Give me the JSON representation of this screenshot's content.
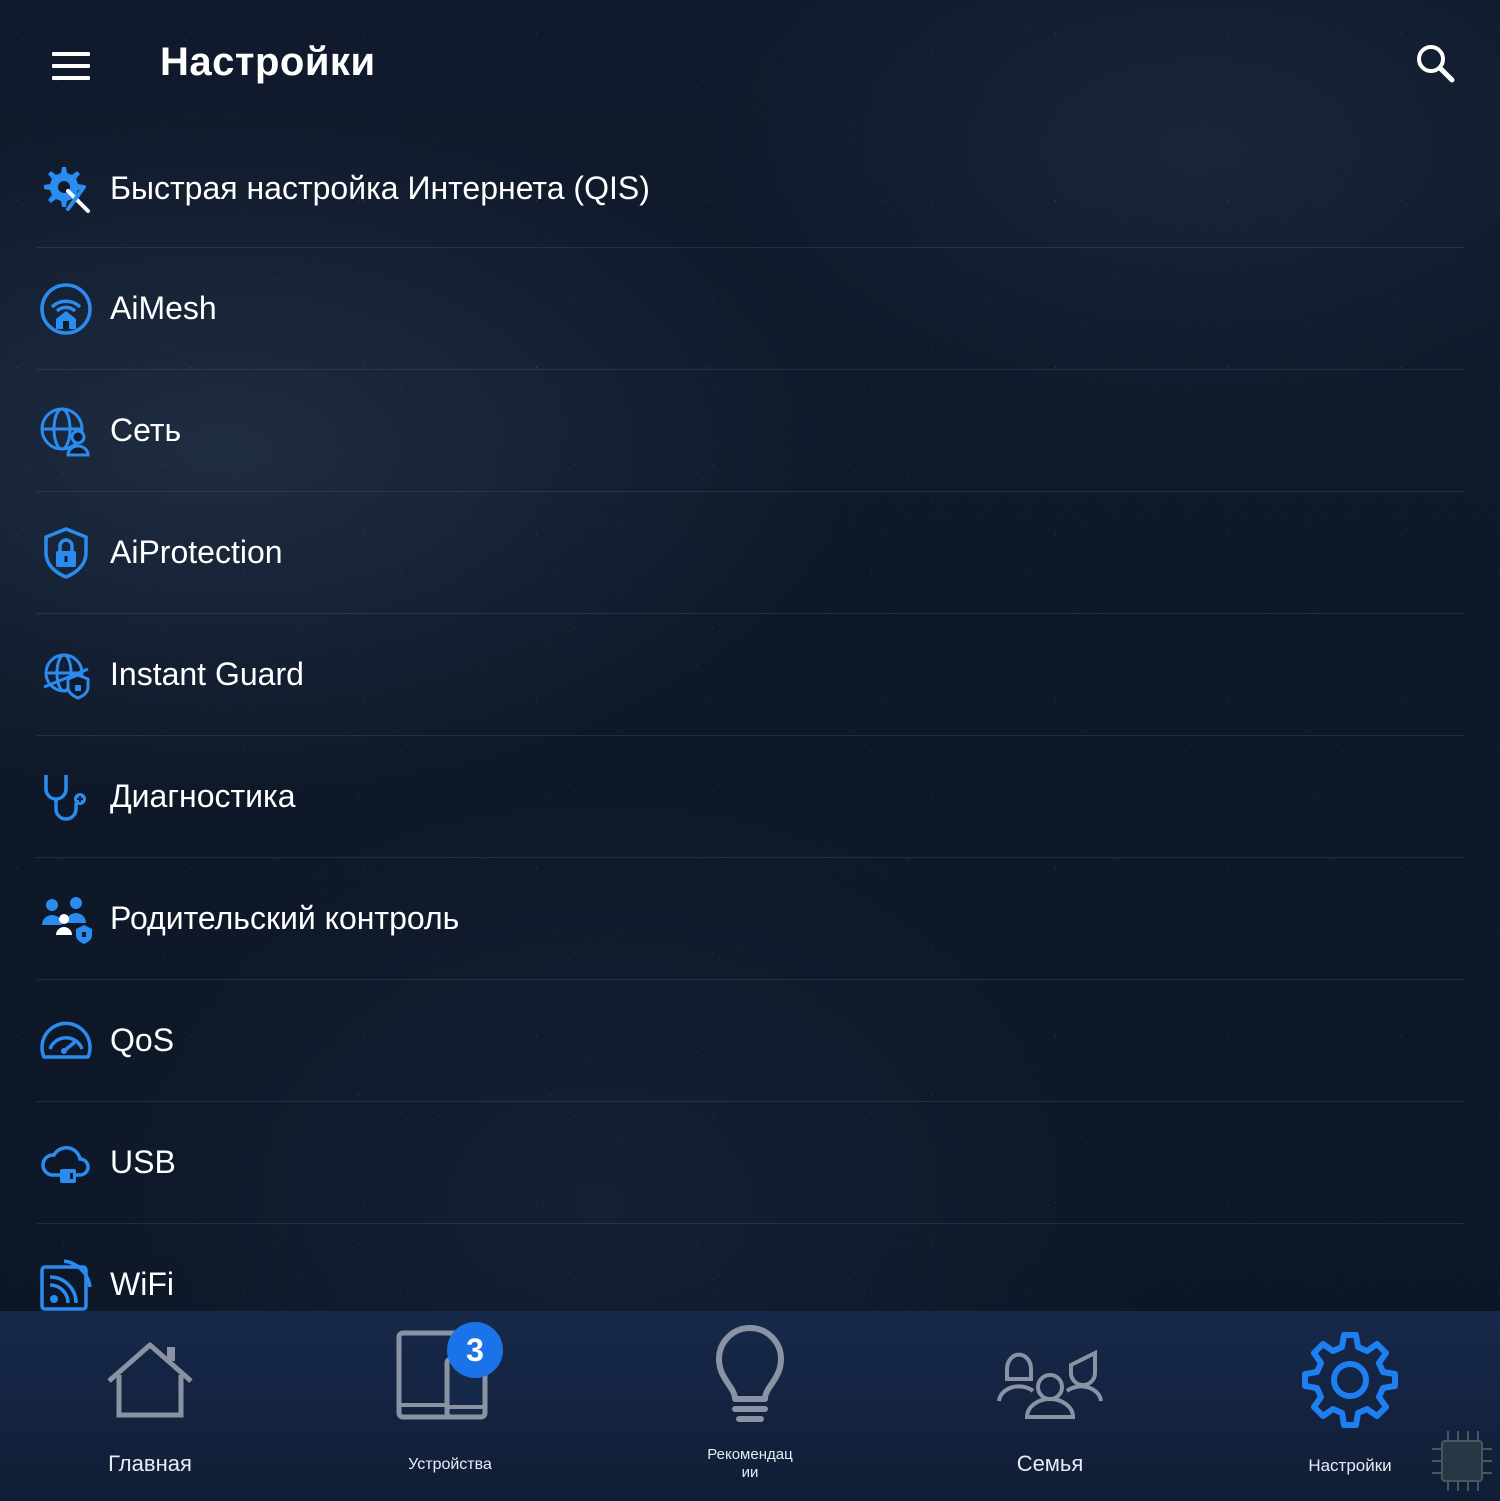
{
  "header": {
    "title": "Настройки",
    "menu_icon": "hamburger-menu-icon",
    "search_icon": "search-icon"
  },
  "settings_list": [
    {
      "label": "Быстрая настройка Интернета (QIS)",
      "icon": "gear-tools-icon"
    },
    {
      "label": "AiMesh",
      "icon": "aimesh-home-wifi-icon"
    },
    {
      "label": "Сеть",
      "icon": "globe-user-icon"
    },
    {
      "label": "AiProtection",
      "icon": "shield-lock-icon"
    },
    {
      "label": "Instant Guard",
      "icon": "globe-shield-icon"
    },
    {
      "label": "Диагностика",
      "icon": "stethoscope-icon"
    },
    {
      "label": "Родительский контроль",
      "icon": "family-lock-icon"
    },
    {
      "label": "QoS",
      "icon": "speedometer-icon"
    },
    {
      "label": "USB",
      "icon": "cloud-usb-icon"
    },
    {
      "label": "WiFi",
      "icon": "wifi-signal-icon"
    }
  ],
  "bottom_nav": [
    {
      "label": "Главная",
      "icon": "home-icon"
    },
    {
      "label": "Устройства",
      "icon": "devices-icon",
      "badge": "3"
    },
    {
      "label": "Рекомендац\nии",
      "icon": "lightbulb-icon"
    },
    {
      "label": "Семья",
      "icon": "family-icon"
    },
    {
      "label": "Настройки",
      "icon": "settings-gear-icon",
      "active": true
    }
  ],
  "colors": {
    "accent": "#2b8cf0",
    "badge": "#1a73e8",
    "nav_background": "#14233f",
    "inactive_icon": "#8a93a3"
  }
}
